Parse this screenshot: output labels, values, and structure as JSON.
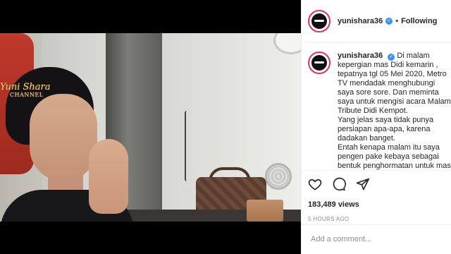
{
  "video": {
    "watermark_title": "Yuni Shara",
    "watermark_subtitle": "CHANNEL"
  },
  "post": {
    "username": "yunishara36",
    "follow_status": "Following",
    "separator": "•",
    "caption_username": "yunishara36",
    "caption_body": "Di malam kepergian mas Didi kemarin , tepatnya tgl 05 Mei 2020, Metro TV mendadak menghubungi saya sore sore. Dan meminta saya untuk mengisi acara Malam Tribute Didi Kempot.\nYang jelas saya tidak punya persiapan apa-apa, karena dadakan banget.\nEntah kenapa malam itu saya pengen pake kebaya sebagai bentuk penghormatan untuk mas Didi. Karena saya belum sempet bersanding duet",
    "likes": "183,489 views",
    "timestamp": "5 HOURS AGO",
    "comment_placeholder": "Add a comment..."
  },
  "icons": [
    "verified-icon",
    "heart-icon",
    "comment-icon",
    "share-icon"
  ]
}
